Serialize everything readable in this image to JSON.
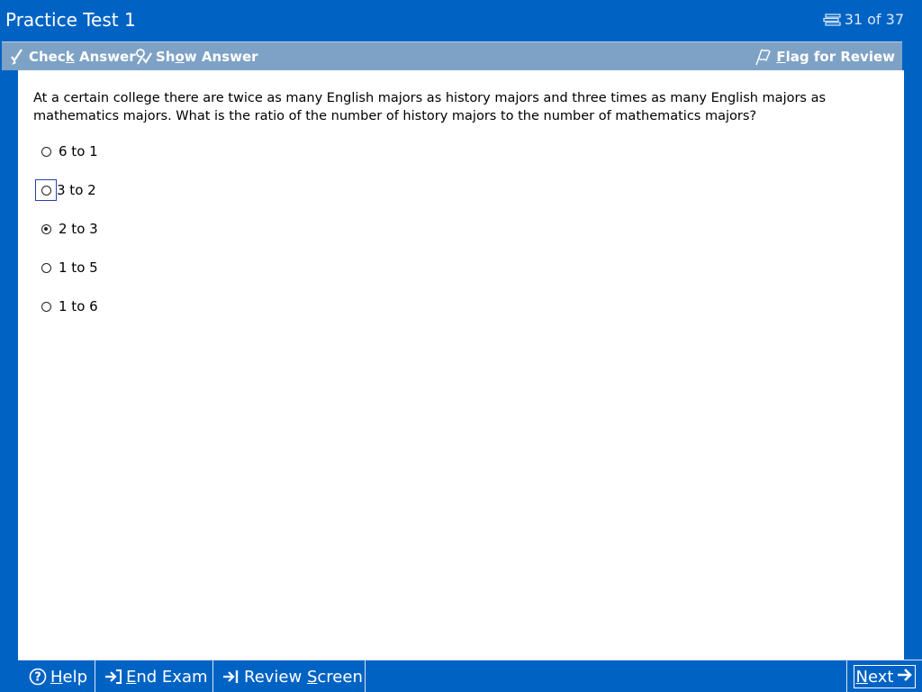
{
  "window": {
    "title": "Practice Test 1",
    "counter": "31 of 37",
    "counter_icon": "list-icon"
  },
  "toolbar": {
    "check_answer": {
      "label_pre": "Chec",
      "label_u": "k",
      "label_post": " Answer",
      "icon": "check-pen-icon"
    },
    "show_answer": {
      "label_pre": "Sh",
      "label_u": "o",
      "label_post": "w Answer",
      "icon": "show-answer-icon"
    },
    "flag": {
      "label_u": "F",
      "label_post": "lag for Review",
      "icon": "flag-icon"
    }
  },
  "question": {
    "text": "At a certain college there are twice as many English majors as history majors and three times as many English majors as mathematics majors.  What is the ratio of the number of history majors to the number of mathematics majors?",
    "options": [
      {
        "label": "6 to 1",
        "selected": false,
        "focused": false
      },
      {
        "label": "3 to 2",
        "selected": false,
        "focused": true
      },
      {
        "label": "2 to 3",
        "selected": true,
        "focused": false
      },
      {
        "label": "1 to 5",
        "selected": false,
        "focused": false
      },
      {
        "label": "1 to 6",
        "selected": false,
        "focused": false
      }
    ]
  },
  "bottombar": {
    "help": {
      "label_u": "H",
      "label_post": "elp",
      "icon": "help-icon"
    },
    "end_exam": {
      "label_u": "E",
      "label_post": "nd Exam",
      "icon": "end-exam-icon"
    },
    "review": {
      "label_pre": "Review ",
      "label_u": "S",
      "label_post": "creen",
      "icon": "review-icon"
    },
    "next": {
      "label_u": "N",
      "label_post": "ext",
      "icon": "arrow-right-icon"
    }
  },
  "colors": {
    "frame_blue": "#0063c4",
    "toolbar_blue": "#7ea2c6",
    "focus_border": "#2b3fb0"
  }
}
